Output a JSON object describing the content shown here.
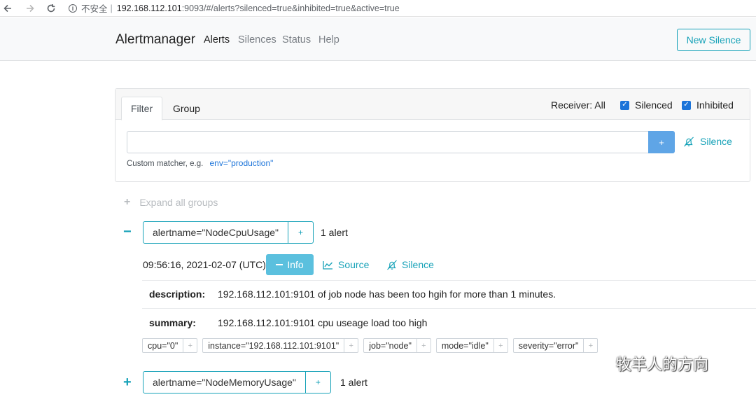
{
  "browser": {
    "insecure_label": "不安全",
    "separator": "|",
    "url_host": "192.168.112.101",
    "url_rest": ":9093/#/alerts?silenced=true&inhibited=true&active=true"
  },
  "navbar": {
    "brand": "Alertmanager",
    "links": [
      "Alerts",
      "Silences",
      "Status",
      "Help"
    ],
    "active_link": "Alerts",
    "new_silence": "New Silence"
  },
  "filter": {
    "tabs": [
      "Filter",
      "Group"
    ],
    "active_tab": "Filter",
    "receiver": "Receiver: All",
    "silenced_label": "Silenced",
    "silenced_checked": true,
    "inhibited_label": "Inhibited",
    "inhibited_checked": true,
    "input_value": "",
    "add_label": "+",
    "silence_label": "Silence",
    "hint_text": "Custom matcher, e.g.",
    "hint_example": "env=\"production\""
  },
  "expand_all": "Expand all groups",
  "groups": [
    {
      "toggle": "−",
      "label": "alertname=\"NodeCpuUsage\"",
      "add": "+",
      "count": "1 alert",
      "expanded": true,
      "alerts": [
        {
          "time": "09:56:16, 2021-02-07 (UTC)",
          "info_label": "Info",
          "source_label": "Source",
          "silence_label": "Silence",
          "annotations": [
            {
              "key": "description:",
              "value": "192.168.112.101:9101 of job node has been too hgih for more than 1 minutes."
            },
            {
              "key": "summary:",
              "value": "192.168.112.101:9101 cpu useage load too high"
            }
          ],
          "labels": [
            {
              "text": "cpu=\"0\"",
              "add": "+"
            },
            {
              "text": "instance=\"192.168.112.101:9101\"",
              "add": "+"
            },
            {
              "text": "job=\"node\"",
              "add": "+"
            },
            {
              "text": "mode=\"idle\"",
              "add": "+"
            },
            {
              "text": "severity=\"error\"",
              "add": "+"
            }
          ]
        }
      ]
    },
    {
      "toggle": "+",
      "label": "alertname=\"NodeMemoryUsage\"",
      "add": "+",
      "count": "1 alert",
      "expanded": false
    }
  ],
  "watermark": "牧羊人的方向",
  "colors": {
    "accent": "#17a2b8",
    "primary": "#1a73d9",
    "info_btn": "#5bc0de"
  }
}
